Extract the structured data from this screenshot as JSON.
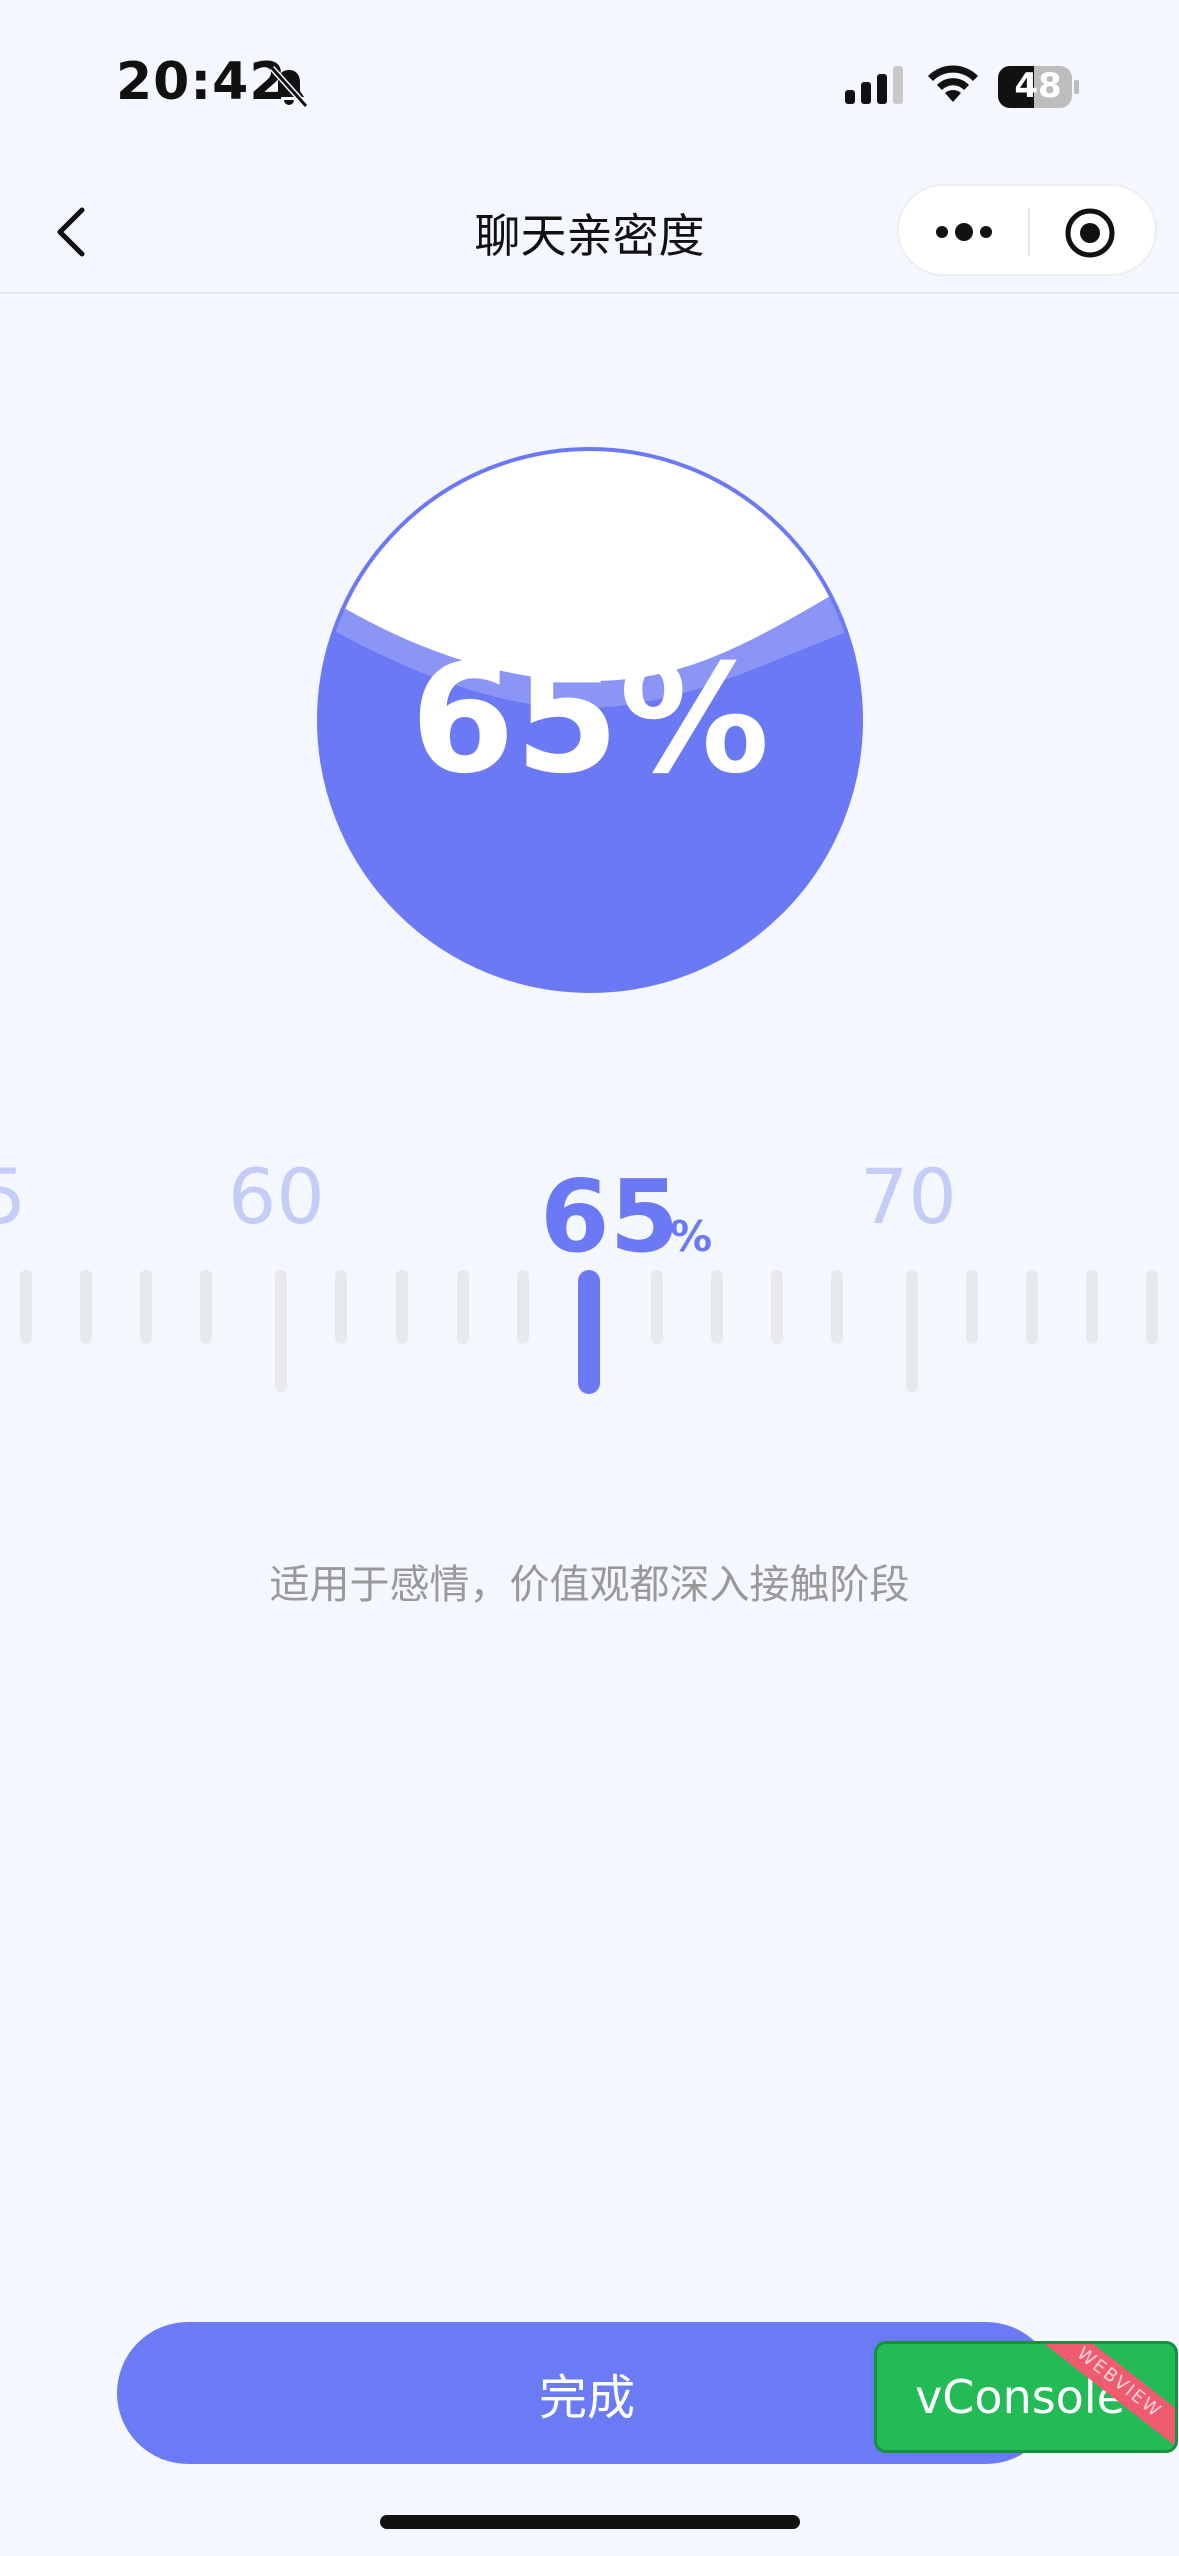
{
  "status_bar": {
    "time": "20:42",
    "battery": "48"
  },
  "nav": {
    "title": "聊天亲密度",
    "back_icon": "chevron-left-icon",
    "more_icon": "more-dots-icon",
    "close_icon": "target-icon"
  },
  "gauge": {
    "percent_text": "65%",
    "fill_level": 0.65,
    "color": "#6b79f5"
  },
  "ruler": {
    "prev_label": "60",
    "next_label": "70",
    "edge_label_left": "5",
    "current_value": "65",
    "current_unit": "%"
  },
  "description": "适用于感情，价值观都深入接触阶段",
  "footer": {
    "done_label": "完成"
  },
  "vconsole": {
    "label": "vConsole",
    "ribbon": "WEBVIEW"
  }
}
